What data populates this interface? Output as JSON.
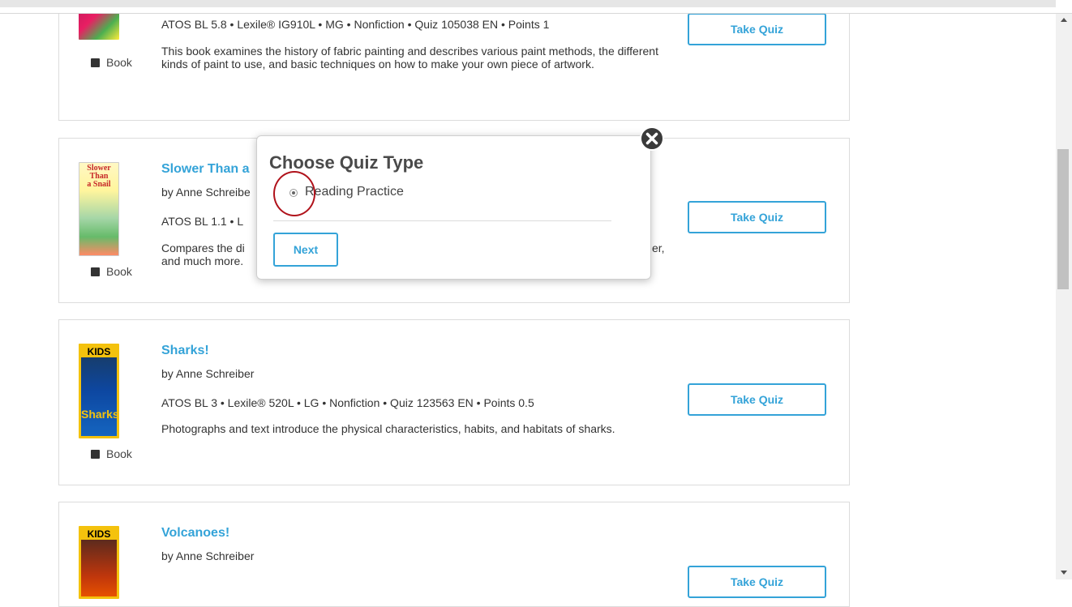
{
  "books": [
    {
      "title": "",
      "author": "",
      "meta": "ATOS BL 5.8 • Lexile® IG910L • MG • Nonfiction • Quiz 105038 EN • Points 1",
      "description": "This book examines the history of fabric painting and describes various paint methods, the different kinds of paint to use, and basic techniques on how to make your own piece of artwork.",
      "type": "Book",
      "button": "Take Quiz"
    },
    {
      "title": "Slower Than a",
      "author": "by Anne Schreibe",
      "meta": "ATOS BL 1.1 • L",
      "description": "Compares the di",
      "description_line2": "and much more.",
      "description_tail": "er,",
      "type": "Book",
      "button": "Take Quiz",
      "cover_text": [
        "Slower",
        "Than",
        "a Snail"
      ]
    },
    {
      "title": "Sharks!",
      "author": "by Anne Schreiber",
      "meta": "ATOS BL 3 • Lexile® 520L • LG • Nonfiction • Quiz 123563 EN • Points 0.5",
      "description": "Photographs and text introduce the physical characteristics, habits, and habitats of sharks.",
      "type": "Book",
      "button": "Take Quiz",
      "cover_brand": "KIDS",
      "cover_title": "Sharks!"
    },
    {
      "title": "Volcanoes!",
      "author": "by Anne Schreiber",
      "button": "Take Quiz",
      "cover_brand": "KIDS"
    }
  ],
  "modal": {
    "title": "Choose Quiz Type",
    "option": "Reading Practice",
    "next": "Next"
  },
  "colors": {
    "accent": "#34a3d8",
    "highlight": "#b0121b"
  }
}
